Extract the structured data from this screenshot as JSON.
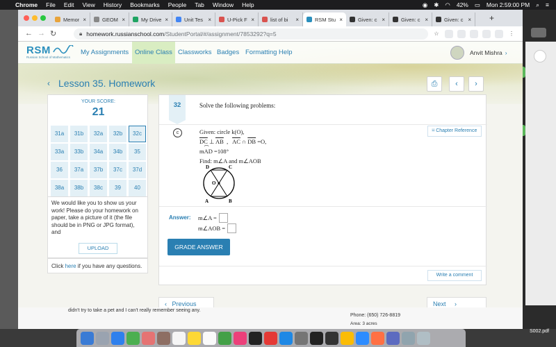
{
  "menubar": {
    "app": "Chrome",
    "items": [
      "File",
      "Edit",
      "View",
      "History",
      "Bookmarks",
      "People",
      "Tab",
      "Window",
      "Help"
    ],
    "battery": "42%",
    "datetime": "Mon 2:59:00 PM"
  },
  "browser": {
    "tabs": [
      {
        "label": "Memori:",
        "color": "#e8a33b"
      },
      {
        "label": "GEOM-C",
        "color": "#888888"
      },
      {
        "label": "My Drive",
        "color": "#1fa463"
      },
      {
        "label": "Unit Tes",
        "color": "#4285f4"
      },
      {
        "label": "U-Pick F",
        "color": "#d9534f"
      },
      {
        "label": "list of bi",
        "color": "#d9534f"
      },
      {
        "label": "RSM Stu",
        "color": "#2a8fbd"
      },
      {
        "label": "Given: c",
        "color": "#333333"
      },
      {
        "label": "Given: c",
        "color": "#333333"
      },
      {
        "label": "Given: c",
        "color": "#333333"
      }
    ],
    "address_host": "homework.russianschool.com",
    "address_path": "/StudentPortal/#/assignment/7853292?q=5"
  },
  "site": {
    "logo_text": "RSM",
    "logo_sub": "Russian School of Mathematics",
    "nav": [
      "My Assignments",
      "Online Class",
      "Classworks",
      "Badges",
      "Formatting Help"
    ],
    "user": "Anvit Mishra",
    "lesson_title": "Lesson 35. Homework"
  },
  "score": {
    "label": "YOUR SCORE:",
    "value": "21",
    "problems": [
      "31a",
      "31b",
      "32a",
      "32b",
      "32c",
      "33a",
      "33b",
      "34a",
      "34b",
      "35",
      "36",
      "37a",
      "37b",
      "37c",
      "37d",
      "38a",
      "38b",
      "38c",
      "39",
      "40"
    ],
    "selected": "32c"
  },
  "upload": {
    "message": "We would like you to show us your work! Please do your homework on paper, take a picture of it (the file should be in PNG or JPG format), and",
    "button": "UPLOAD"
  },
  "help": {
    "prefix": "Click ",
    "link": "here",
    "suffix": " if you have any questions."
  },
  "problem": {
    "number": "32",
    "heading": "Solve the following problems:",
    "part": "c",
    "chapter_ref": "Chapter Reference",
    "given": "Given: circle k(O),",
    "line2": {
      "a": "DC",
      "perp": "⊥",
      "b": "AB",
      "c": "AC",
      "cap": "∩",
      "d": "DB",
      "eq": "=O,"
    },
    "line3": {
      "m": "m",
      "arc": "AD",
      "eq": "=108°"
    },
    "find": "Find: m∠A and m∠AOB",
    "diagram_labels": {
      "D": "D",
      "C": "C",
      "O": "O",
      "A": "A",
      "B": "B"
    },
    "answer_label": "Answer:",
    "answers": [
      "m∠A =",
      "m∠AOB ="
    ],
    "grade_button": "GRADE ANSWER",
    "comment_button": "Write a comment"
  },
  "pager": {
    "prev": "Previous",
    "next": "Next"
  },
  "behind_window": {
    "text1": "didn't try to take a pet and I can't really remember seeing any.",
    "text2": "Phone: (650) 726-8819",
    "text3": "Area: 3 acres",
    "file": "S002.pdf"
  }
}
